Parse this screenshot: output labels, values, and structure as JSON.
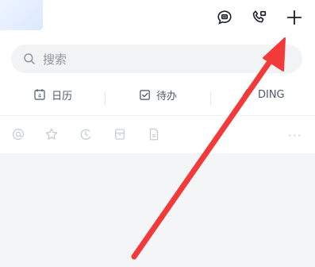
{
  "search": {
    "placeholder": "搜索"
  },
  "shortcuts": [
    {
      "label": "日历",
      "badge": "4",
      "icon": "calendar-icon"
    },
    {
      "label": "待办",
      "icon": "todo-checkbox-icon"
    },
    {
      "label": "DING",
      "icon": "ding-lightning-icon"
    }
  ],
  "top_actions": [
    "chat-bubble-icon",
    "phone-video-icon",
    "plus-icon"
  ],
  "annotation": {
    "color": "#f23a3a"
  },
  "more": "···"
}
